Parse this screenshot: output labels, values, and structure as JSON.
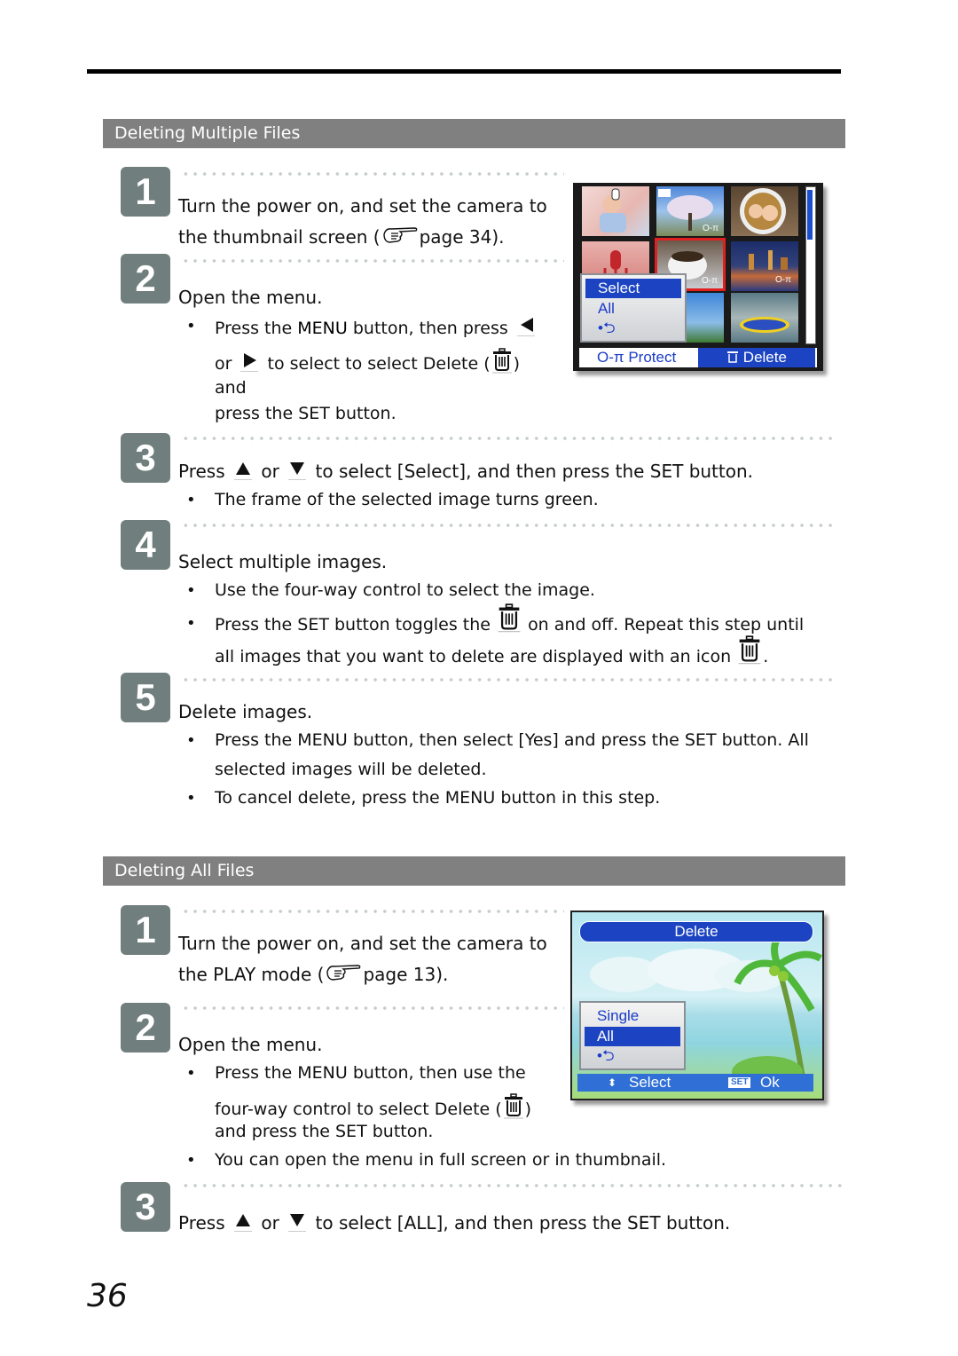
{
  "page_number": "36",
  "sections": [
    {
      "title": "Deleting Multiple Files",
      "steps": [
        {
          "num": "1",
          "line1": "Turn the power on, and set the camera to",
          "line2_pre": "the thumbnail screen (",
          "line2_post": "page 34)."
        },
        {
          "num": "2",
          "title": "Open the menu.",
          "b1_pre": "Press the ",
          "b1_bold": "MENU",
          "b1_post": " button, then press",
          "b1_l2_pre": "or",
          "b1_l2_mid": " to select to select ",
          "b1_l2_bold": "Delete",
          "b1_l2_open": " (",
          "b1_l2_close": ")",
          "b1_l3": "and",
          "b1_l4_pre": "press the ",
          "b1_l4_bold": "SET",
          "b1_l4_post": " button."
        },
        {
          "num": "3",
          "pre": "Press",
          "mid": "or",
          "post": "to select [Select], and then press the SET button.",
          "bullet": "The frame of the selected image turns green."
        },
        {
          "num": "4",
          "title": "Select multiple images.",
          "bullet1": "Use the four-way control to select the image.",
          "bullet2_pre": "Press the ",
          "bullet2_bold": "SET",
          "bullet2_mid": " button toggles the",
          "bullet2_post": "on and off. Repeat this step until",
          "bullet2_l2": "all images that you want to delete are displayed with an icon",
          "bullet2_l2_end": "."
        },
        {
          "num": "5",
          "title": "Delete images.",
          "bullet1_pre": "Press the ",
          "bullet1_bold": "MENU",
          "bullet1_mid": " button, then select [Yes] and press the ",
          "bullet1_bold2": "SET",
          "bullet1_post": " button. All",
          "bullet1_l2": "selected images will be deleted.",
          "bullet2_pre": "To cancel delete, press the ",
          "bullet2_bold": "MENU",
          "bullet2_post": " button in this step."
        }
      ],
      "camera_screen": {
        "menu_items": [
          "Select",
          "All",
          "•⮌"
        ],
        "selected_index": 0,
        "protect_label": "Protect",
        "delete_label": "Delete"
      }
    },
    {
      "title": "Deleting All Files",
      "steps": [
        {
          "num": "1",
          "line1": "Turn the power on, and set the camera to",
          "line2_pre": "the PLAY mode (",
          "line2_post": "page 13)."
        },
        {
          "num": "2",
          "title": "Open the menu.",
          "b1_pre": "Press the ",
          "b1_bold": "MENU",
          "b1_post": " button, then use the",
          "b1_l2_pre": "four-way control to select ",
          "b1_l2_bold": "Delete",
          "b1_l2_open": " (",
          "b1_l2_close": ")",
          "b1_l3_pre": "and press the ",
          "b1_l3_bold": "SET",
          "b1_l3_post": " button.",
          "b2": "You can open the menu in full screen or in thumbnail."
        },
        {
          "num": "3",
          "pre": "Press",
          "mid": "or",
          "post": "to select [ALL], and then press the SET button."
        }
      ],
      "camera_screen": {
        "title": "Delete",
        "menu_items": [
          "Single",
          "All",
          "•⮌"
        ],
        "selected_index": 1,
        "select_label": "Select",
        "set_badge": "SET",
        "ok_label": "Ok"
      }
    }
  ],
  "colors": {
    "section_bar": "#808080",
    "step_badge": "#707e7d",
    "menu_blue": "#1b43c2",
    "highlight_red": "#e02020"
  }
}
